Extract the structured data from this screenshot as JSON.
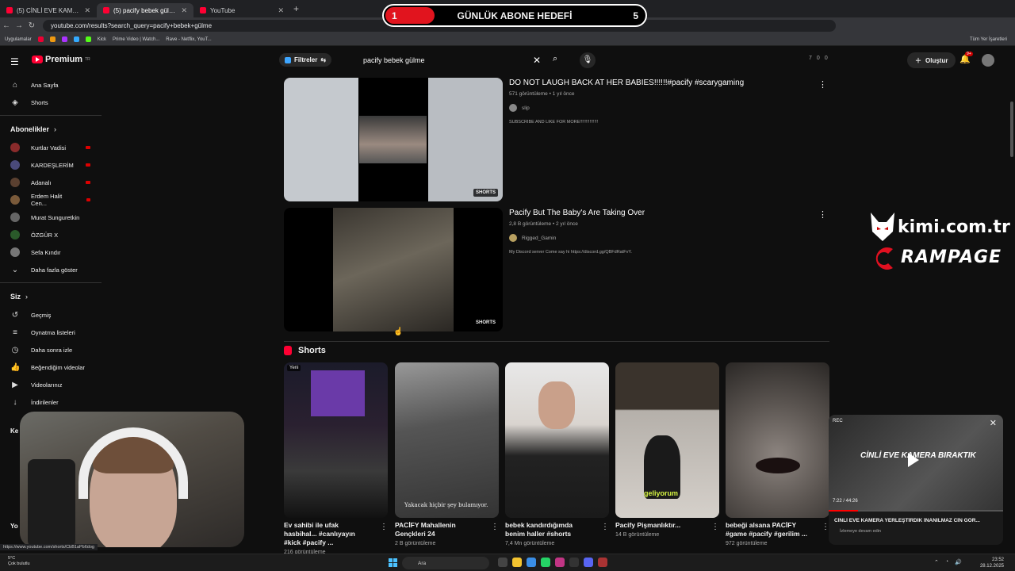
{
  "browser": {
    "tabs": [
      {
        "label": "(5) CİNLİ EVE KAMERA YERLEŞTİ...",
        "active": false
      },
      {
        "label": "(5) pacify bebek gülme - YouTube",
        "active": true
      },
      {
        "label": "YouTube",
        "active": false
      }
    ],
    "new_tab": "+",
    "url": "youtube.com/results?search_query=pacify+bebek+gülme",
    "bookmarks": [
      "Uygulamalar",
      "Kick",
      "Prime Video | Watch...",
      "Rave - Netflix, YouT..."
    ],
    "all_bookmarks": "Tüm Yer İşaretleri"
  },
  "overlay_goal": {
    "left": "1",
    "title": "GÜNLÜK ABONE HEDEFİ",
    "right": "5"
  },
  "header": {
    "logo": "Premium",
    "logo_sup": "TR",
    "filters": "Filtreler",
    "search_value": "pacify bebek gülme",
    "counters": [
      "7",
      "0",
      "0"
    ],
    "create": "Oluştur",
    "notif_badge": "9+"
  },
  "sidebar": {
    "main": [
      {
        "label": "Ana Sayfa",
        "icon": "home-icon"
      },
      {
        "label": "Shorts",
        "icon": "shorts-icon"
      }
    ],
    "subs_title": "Abonelikler",
    "subs": [
      {
        "label": "Kurtlar Vadisi",
        "color": "#8a2b2b"
      },
      {
        "label": "KARDEŞLERİM",
        "color": "#4a4a7a"
      },
      {
        "label": "Adanalı",
        "color": "#5a4030"
      },
      {
        "label": "Erdem Halit Cen...",
        "color": "#7a5a3a"
      },
      {
        "label": "Murat Sunguretkin",
        "color": "#666"
      },
      {
        "label": "ÖZGÜR X",
        "color": "#2a5a2a"
      },
      {
        "label": "Sefa Kındır",
        "color": "#777"
      }
    ],
    "more": "Daha fazla göster",
    "you_title": "Siz",
    "you": [
      {
        "label": "Geçmiş",
        "icon": "history-icon"
      },
      {
        "label": "Oynatma listeleri",
        "icon": "playlist-icon"
      },
      {
        "label": "Daha sonra izle",
        "icon": "clock-icon"
      },
      {
        "label": "Beğendiğim videolar",
        "icon": "like-icon"
      },
      {
        "label": "Videolarınız",
        "icon": "video-icon"
      },
      {
        "label": "İndirilenler",
        "icon": "download-icon"
      }
    ],
    "cut_label_1": "Ke",
    "cut_label_2": "Yo"
  },
  "results": [
    {
      "title": "DO NOT LAUGH BACK AT HER BABIES!!!!!!#pacify #scarygaming",
      "meta": "571 görüntüleme • 1 yıl önce",
      "channel": "slip",
      "desc": "SUBSCRIBE AND LIKE FOR MORE!!!!!!!!!!!!!!!",
      "badge": "SHORTS"
    },
    {
      "title": "Pacify But The Baby's Are Taking Over",
      "meta": "2,8 B görüntüleme • 2 yıl önce",
      "channel": "Rigged_Gamin",
      "desc": "My Discord server Come say hi https://discord.gg/QBFdRatFvY.",
      "badge": "SHORTS"
    }
  ],
  "shorts": {
    "title": "Shorts",
    "items": [
      {
        "title": "Ev sahibi ile ufak hasbihal... #canlıyayın #kick #pacify ...",
        "views": "216 görüntüleme",
        "new": "Yeni"
      },
      {
        "title": "PACİFY Mahallenin Gençkleri 24",
        "views": "2 B görüntüleme",
        "caption": "Yakacak hiçbir şey bulamıyor."
      },
      {
        "title": "bebek kandırdığımda benim haller #shorts",
        "views": "7,4 Mn görüntüleme"
      },
      {
        "title": "Pacify Pişmanlıktır...",
        "views": "14 B görüntüleme",
        "caption": "geliyorum"
      },
      {
        "title": "bebeği alsana PACİFY #game #pacify #gerilim ...",
        "views": "972 görüntüleme"
      }
    ]
  },
  "sponsor": {
    "line1": "kimi.com.tr",
    "line2": "RAMPAGE"
  },
  "miniplayer": {
    "rec": "REC",
    "overlay_text": "CİNLİ EVE KAMERA BIRAKTIK",
    "time": "7:22 / 44:26",
    "progress": 0.166,
    "title": "CİNLİ EVE KAMERA YERLEŞTİRDİK İNANILMAZ CİN GÖR...",
    "sub": "İzlemeye devam edin"
  },
  "status_url": "https://www.youtube.com/shorts/CbB1aPb6dog",
  "taskbar": {
    "temp": "5°C",
    "weather": "Çok bulutlu",
    "search": "Ara",
    "time": "23:52",
    "date": "28.12.2025"
  }
}
